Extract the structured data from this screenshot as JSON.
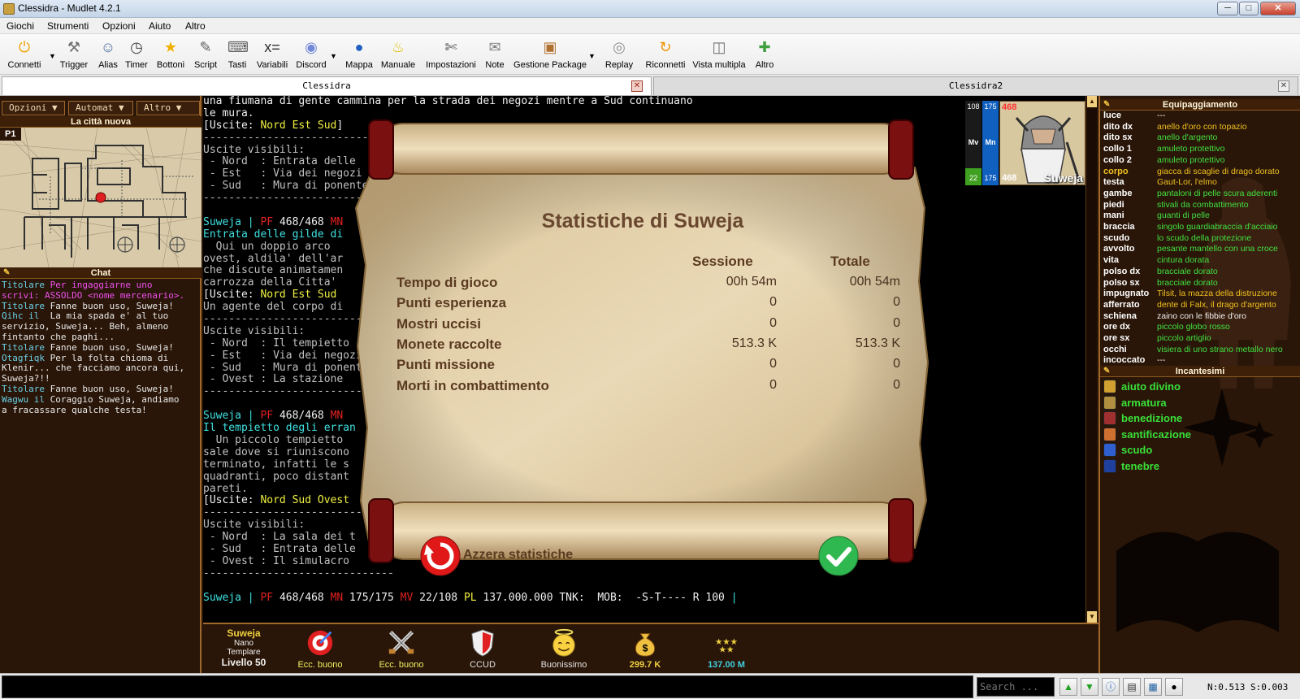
{
  "window": {
    "title": "Clessidra - Mudlet 4.2.1",
    "buttons": {
      "minimize": "─",
      "maximize": "□",
      "close": "✕"
    }
  },
  "menubar": [
    "Giochi",
    "Strumenti",
    "Opzioni",
    "Aiuto",
    "Altro"
  ],
  "toolbar": [
    {
      "label": "Connetti",
      "icon": "power-icon",
      "glyph": "⏻",
      "color": "#f0a000",
      "dropdown": true
    },
    {
      "label": "Trigger",
      "icon": "hammer-icon",
      "glyph": "⚒",
      "color": "#707070",
      "dropdown": false
    },
    {
      "label": "Alias",
      "icon": "people-icon",
      "glyph": "☺",
      "color": "#5070a0",
      "dropdown": false
    },
    {
      "label": "Timer",
      "icon": "clock-icon",
      "glyph": "◷",
      "color": "#404040",
      "dropdown": false
    },
    {
      "label": "Bottoni",
      "icon": "star-icon",
      "glyph": "★",
      "color": "#f0b000",
      "dropdown": false
    },
    {
      "label": "Script",
      "icon": "pencil-icon",
      "glyph": "✎",
      "color": "#606060",
      "dropdown": false
    },
    {
      "label": "Tasti",
      "icon": "keyboard-icon",
      "glyph": "⌨",
      "color": "#606060",
      "dropdown": false
    },
    {
      "label": "Variabili",
      "icon": "variables-icon",
      "glyph": "x=",
      "color": "#303030",
      "dropdown": false
    },
    {
      "label": "Discord",
      "icon": "discord-icon",
      "glyph": "◉",
      "color": "#7289da",
      "dropdown": true
    },
    {
      "label": "Mappa",
      "icon": "globe-icon",
      "glyph": "●",
      "color": "#2060c0",
      "dropdown": false
    },
    {
      "label": "Manuale",
      "icon": "lightbulb-icon",
      "glyph": "♨",
      "color": "#e0c000",
      "dropdown": false
    },
    {
      "label": "Impostazioni",
      "icon": "wrench-icon",
      "glyph": "✄",
      "color": "#505050",
      "dropdown": false
    },
    {
      "label": "Note",
      "icon": "note-icon",
      "glyph": "✉",
      "color": "#808080",
      "dropdown": false
    },
    {
      "label": "Gestione Package",
      "icon": "package-icon",
      "glyph": "▣",
      "color": "#b07030",
      "dropdown": true
    },
    {
      "label": "Replay",
      "icon": "disc-icon",
      "glyph": "◎",
      "color": "#909090",
      "dropdown": false
    },
    {
      "label": "Riconnetti",
      "icon": "reconnect-icon",
      "glyph": "↻",
      "color": "#f09000",
      "dropdown": false
    },
    {
      "label": "Vista multipla",
      "icon": "multiview-icon",
      "glyph": "◫",
      "color": "#707070",
      "dropdown": false
    },
    {
      "label": "Altro",
      "icon": "puzzle-icon",
      "glyph": "✚",
      "color": "#40a040",
      "dropdown": false
    }
  ],
  "tabs": [
    {
      "label": "Clessidra",
      "active": true
    },
    {
      "label": "Clessidra2",
      "active": false
    }
  ],
  "left": {
    "menus": [
      "Opzioni ▼",
      "Automat ▼",
      "Altro ▼"
    ],
    "map_title": "La città nuova",
    "map_badge": "P1",
    "chat_title": "Chat",
    "chat": [
      [
        {
          "t": "Titolare ",
          "c": "c-cyan"
        },
        {
          "t": "Per ingaggiarne uno",
          "c": "c-mag"
        }
      ],
      [
        {
          "t": "scrivi: ASSOLDO <nome mercenario>.",
          "c": "c-mag"
        }
      ],
      [
        {
          "t": "Titolare ",
          "c": "c-cyan"
        },
        {
          "t": "Fanne buon uso, Suweja!",
          "c": ""
        }
      ],
      [
        {
          "t": "Qihc il ",
          "c": "c-cyan"
        },
        {
          "t": " La mia spada e' al tuo",
          "c": ""
        }
      ],
      [
        {
          "t": "servizio, Suweja... Beh, almeno",
          "c": ""
        }
      ],
      [
        {
          "t": "fintanto che paghi...",
          "c": ""
        }
      ],
      [
        {
          "t": "Titolare ",
          "c": "c-cyan"
        },
        {
          "t": "Fanne buon uso, Suweja!",
          "c": ""
        }
      ],
      [
        {
          "t": "Otagfiqk ",
          "c": "c-cyan"
        },
        {
          "t": "Per la folta chioma di",
          "c": ""
        }
      ],
      [
        {
          "t": "Klenir... che facciamo ancora qui,",
          "c": ""
        }
      ],
      [
        {
          "t": "Suweja?!!",
          "c": ""
        }
      ],
      [
        {
          "t": "Titolare ",
          "c": "c-cyan"
        },
        {
          "t": "Fanne buon uso, Suweja!",
          "c": ""
        }
      ],
      [
        {
          "t": "Wagwu il ",
          "c": "c-cyan"
        },
        {
          "t": "Coraggio Suweja, andiamo",
          "c": ""
        }
      ],
      [
        {
          "t": "a fracassare qualche testa!",
          "c": ""
        }
      ]
    ]
  },
  "console": [
    [
      {
        "t": "una fiumana di gente cammina per la strada dei negozi mentre a Sud continuano",
        "c": "c-wht"
      }
    ],
    [
      {
        "t": "le mura.",
        "c": "c-wht"
      }
    ],
    [
      {
        "t": "[Uscite: ",
        "c": "c-wht"
      },
      {
        "t": "Nord Est Sud",
        "c": "c-yel"
      },
      {
        "t": "]",
        "c": "c-wht"
      }
    ],
    [
      {
        "t": "------------------------------",
        "c": ""
      }
    ],
    [
      {
        "t": "Uscite visibili:",
        "c": ""
      }
    ],
    [
      {
        "t": " - Nord  : Entrata delle",
        "c": ""
      }
    ],
    [
      {
        "t": " - Est   : Via dei negozi",
        "c": ""
      }
    ],
    [
      {
        "t": " - Sud   : Mura di ponente",
        "c": ""
      }
    ],
    [
      {
        "t": "------------------------------",
        "c": ""
      }
    ],
    [
      {
        "t": "",
        "c": ""
      }
    ],
    [
      {
        "t": "Suweja | ",
        "c": "c-aq"
      },
      {
        "t": "PF ",
        "c": "c-red"
      },
      {
        "t": "468/468 ",
        "c": "c-wht"
      },
      {
        "t": "MN",
        "c": "c-red"
      }
    ],
    [
      {
        "t": "Entrata delle gilde di",
        "c": "c-aq"
      }
    ],
    [
      {
        "t": "  Qui un doppio arco",
        "c": ""
      }
    ],
    [
      {
        "t": "ovest, aldila' dell'ar",
        "c": ""
      }
    ],
    [
      {
        "t": "che discute animatamen",
        "c": ""
      }
    ],
    [
      {
        "t": "carrozza della Citta' ",
        "c": ""
      }
    ],
    [
      {
        "t": "[Uscite: ",
        "c": "c-wht"
      },
      {
        "t": "Nord Est Sud",
        "c": "c-yel"
      }
    ],
    [
      {
        "t": "Un agente del corpo di",
        "c": ""
      }
    ],
    [
      {
        "t": "------------------------------",
        "c": ""
      }
    ],
    [
      {
        "t": "Uscite visibili:",
        "c": ""
      }
    ],
    [
      {
        "t": " - Nord  : Il tempietto",
        "c": ""
      }
    ],
    [
      {
        "t": " - Est   : Via dei negozi",
        "c": ""
      }
    ],
    [
      {
        "t": " - Sud   : Mura di ponente",
        "c": ""
      }
    ],
    [
      {
        "t": " - Ovest : La stazione",
        "c": ""
      }
    ],
    [
      {
        "t": "------------------------------",
        "c": ""
      }
    ],
    [
      {
        "t": "",
        "c": ""
      }
    ],
    [
      {
        "t": "Suweja | ",
        "c": "c-aq"
      },
      {
        "t": "PF ",
        "c": "c-red"
      },
      {
        "t": "468/468 ",
        "c": "c-wht"
      },
      {
        "t": "MN",
        "c": "c-red"
      }
    ],
    [
      {
        "t": "Il tempietto degli erran",
        "c": "c-aq"
      }
    ],
    [
      {
        "t": "  Un piccolo tempietto",
        "c": ""
      }
    ],
    [
      {
        "t": "sale dove si riuniscono",
        "c": ""
      }
    ],
    [
      {
        "t": "terminato, infatti le s",
        "c": ""
      }
    ],
    [
      {
        "t": "quadranti, poco distant",
        "c": ""
      }
    ],
    [
      {
        "t": "pareti.",
        "c": ""
      }
    ],
    [
      {
        "t": "[Uscite: ",
        "c": "c-wht"
      },
      {
        "t": "Nord Sud Ovest",
        "c": "c-yel"
      }
    ],
    [
      {
        "t": "------------------------------",
        "c": ""
      }
    ],
    [
      {
        "t": "Uscite visibili:",
        "c": ""
      }
    ],
    [
      {
        "t": " - Nord  : La sala dei t",
        "c": ""
      }
    ],
    [
      {
        "t": " - Sud   : Entrata delle",
        "c": ""
      }
    ],
    [
      {
        "t": " - Ovest : Il simulacro",
        "c": ""
      }
    ],
    [
      {
        "t": "------------------------------",
        "c": ""
      }
    ],
    [
      {
        "t": "",
        "c": ""
      }
    ],
    [
      {
        "t": "Suweja | ",
        "c": "c-aq"
      },
      {
        "t": "PF ",
        "c": "c-red"
      },
      {
        "t": "468/468 ",
        "c": "c-wht"
      },
      {
        "t": "MN ",
        "c": "c-red"
      },
      {
        "t": "175/175 ",
        "c": "c-wht"
      },
      {
        "t": "MV ",
        "c": "c-red"
      },
      {
        "t": "22/108 ",
        "c": "c-wht"
      },
      {
        "t": "PL ",
        "c": "c-yel"
      },
      {
        "t": "137.000.000 TNK:  MOB:  -S-T---- ",
        "c": "c-wht"
      },
      {
        "t": "R ",
        "c": "c-wht"
      },
      {
        "t": "100 ",
        "c": "c-wht"
      },
      {
        "t": "|",
        "c": "c-aq"
      }
    ]
  ],
  "dialog": {
    "title": "Statistiche di Suweja",
    "col_session": "Sessione",
    "col_total": "Totale",
    "rows": [
      {
        "label": "Tempo di gioco",
        "session": "00h 54m",
        "total": "00h 54m"
      },
      {
        "label": "Punti esperienza",
        "session": "0",
        "total": "0"
      },
      {
        "label": "Mostri uccisi",
        "session": "0",
        "total": "0"
      },
      {
        "label": "Monete raccolte",
        "session": "513.3 K",
        "total": "513.3 K"
      },
      {
        "label": "Punti missione",
        "session": "0",
        "total": "0"
      },
      {
        "label": "Morti in combattimento",
        "session": "0",
        "total": "0"
      }
    ],
    "reset_label": "Azzera statistiche"
  },
  "character": {
    "bars": [
      {
        "top": "108",
        "mid": "Mv",
        "bottom": "22",
        "color": "#40a020",
        "level": 0.2
      },
      {
        "top": "175",
        "mid": "Mn",
        "bottom": "175",
        "color": "#1060c0",
        "level": 1.0
      }
    ],
    "hp_top": "468",
    "hp_bottom": "468",
    "name": "Suweja"
  },
  "equipment": {
    "title": "Equipaggiamento",
    "rows": [
      {
        "slot": "luce",
        "item": "---",
        "c": "#f0f0f0"
      },
      {
        "slot": "dito dx",
        "item": "anello d'oro con topazio",
        "c": "#f0c020"
      },
      {
        "slot": "dito sx",
        "item": "anello d'argento",
        "c": "#40e040"
      },
      {
        "slot": "collo 1",
        "item": "amuleto protettivo",
        "c": "#40e040"
      },
      {
        "slot": "collo 2",
        "item": "amuleto protettivo",
        "c": "#40e040"
      },
      {
        "slot": "corpo",
        "item": "giacca di scaglie di drago dorato",
        "c": "#f0c020",
        "slotc": "#f0c020"
      },
      {
        "slot": "testa",
        "item": "Gaut-Lor, l'elmo",
        "c": "#f0c020"
      },
      {
        "slot": "gambe",
        "item": "pantaloni di pelle scura aderenti",
        "c": "#40e040"
      },
      {
        "slot": "piedi",
        "item": "stivali da combattimento",
        "c": "#40e040"
      },
      {
        "slot": "mani",
        "item": "guanti di pelle",
        "c": "#40e040"
      },
      {
        "slot": "braccia",
        "item": "singolo guardiabraccia d'acciaio",
        "c": "#40e040"
      },
      {
        "slot": "scudo",
        "item": "lo scudo della protezione",
        "c": "#40e040"
      },
      {
        "slot": "avvolto",
        "item": "pesante mantello con una croce",
        "c": "#40e040"
      },
      {
        "slot": "vita",
        "item": "cintura dorata",
        "c": "#40e040"
      },
      {
        "slot": "polso dx",
        "item": "bracciale dorato",
        "c": "#40e040"
      },
      {
        "slot": "polso sx",
        "item": "bracciale dorato",
        "c": "#40e040"
      },
      {
        "slot": "impugnato",
        "item": "Tilsit, la mazza della distruzione",
        "c": "#f0c020"
      },
      {
        "slot": "afferrato",
        "item": "dente di Falx, il drago d'argento",
        "c": "#f0c020"
      },
      {
        "slot": "schiena",
        "item": "zaino con le fibbie d'oro",
        "c": "#f0f0f0"
      },
      {
        "slot": "ore dx",
        "item": "piccolo globo rosso",
        "c": "#40e040"
      },
      {
        "slot": "ore sx",
        "item": "piccolo artiglio",
        "c": "#40e040"
      },
      {
        "slot": "occhi",
        "item": "visiera di uno strano metallo nero",
        "c": "#40e040"
      },
      {
        "slot": "incoccato",
        "item": "---",
        "c": "#f0f0f0"
      }
    ]
  },
  "spells": {
    "title": "Incantesimi",
    "rows": [
      {
        "name": "aiuto divino",
        "icon": "divine-aid-icon",
        "color": "#d0a030"
      },
      {
        "name": "armatura",
        "icon": "armor-spell-icon",
        "color": "#b09040"
      },
      {
        "name": "benedizione",
        "icon": "blessing-icon",
        "color": "#a03030"
      },
      {
        "name": "santificazione",
        "icon": "sanctify-icon",
        "color": "#d07030"
      },
      {
        "name": "scudo",
        "icon": "shield-spell-icon",
        "color": "#3060d0"
      },
      {
        "name": "tenebre",
        "icon": "darkness-icon",
        "color": "#2040a0"
      }
    ]
  },
  "status": {
    "char": {
      "name": "Suweja",
      "race": "Nano",
      "class": "Templare",
      "level": "Livello 50"
    },
    "stats": [
      {
        "label": "Ecc. buono",
        "icon": "target-icon",
        "color": "#f0f060"
      },
      {
        "label": "Ecc. buono",
        "icon": "crossed-swords-icon",
        "color": "#f0f060"
      },
      {
        "label": "CCUD",
        "icon": "shield-icon",
        "color": "#e0e0e0"
      },
      {
        "label": "Buonissimo",
        "icon": "smiley-angel-icon",
        "color": "#e0e0e0"
      },
      {
        "label": "299.7 K",
        "icon": "money-bag-icon",
        "color": "#f0d040"
      },
      {
        "label": "137.00 M",
        "icon": "stars-icon",
        "color": "#40d0e0"
      }
    ]
  },
  "cmd": {
    "value": "",
    "search_placeholder": "Search ...",
    "netstat": "N:0.513 S:0.003"
  }
}
